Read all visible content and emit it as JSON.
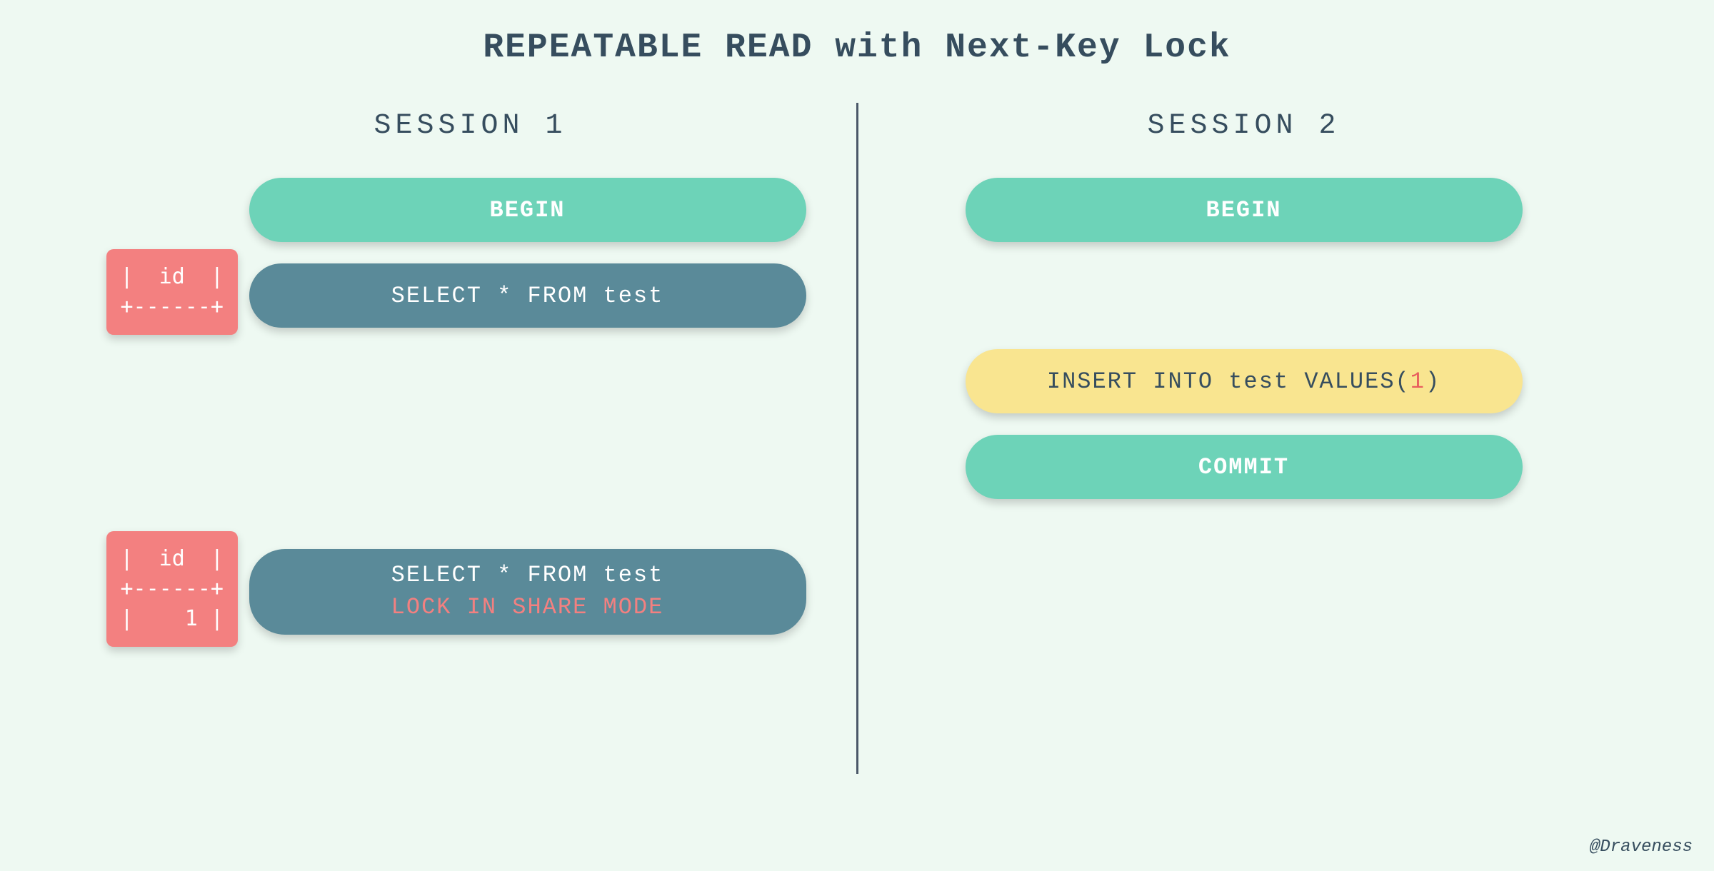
{
  "title": "REPEATABLE READ with Next-Key Lock",
  "session1": {
    "label": "SESSION 1",
    "begin": "BEGIN",
    "select1": "SELECT * FROM test",
    "result1_line1": "|  id  |",
    "result1_line2": "+------+",
    "select2_line1": "SELECT * FROM test",
    "select2_line2": "LOCK IN SHARE MODE",
    "result2_line1": "|  id  |",
    "result2_line2": "+------+",
    "result2_line3": "|    1 |"
  },
  "session2": {
    "label": "SESSION 2",
    "begin": "BEGIN",
    "insert_prefix": "INSERT INTO test VALUES(",
    "insert_value": "1",
    "insert_suffix": ")",
    "commit": "COMMIT"
  },
  "credit": "@Draveness"
}
